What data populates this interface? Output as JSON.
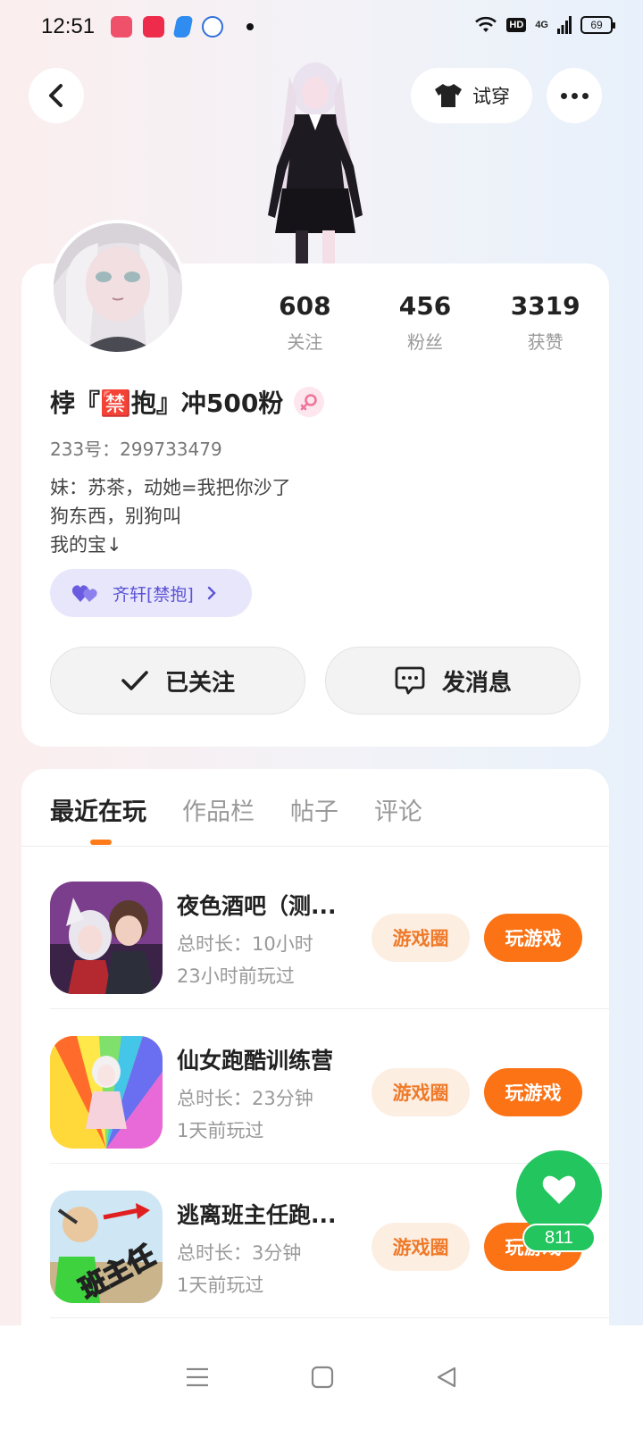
{
  "status": {
    "time": "12:51",
    "network": "4G",
    "hd": "HD",
    "battery": "69"
  },
  "header": {
    "tryon_label": "试穿"
  },
  "profile": {
    "stats": [
      {
        "value": "608",
        "label": "关注"
      },
      {
        "value": "456",
        "label": "粉丝"
      },
      {
        "value": "3319",
        "label": "获赞"
      }
    ],
    "username": "桲『🈲抱』冲500粉",
    "account_id": "233号：299733479",
    "bio": [
      "妹：苏茶，动她=我把你沙了",
      "狗东西，别狗叫",
      "我的宝↓"
    ],
    "couple_label": "齐轩[禁抱]",
    "follow_label": "已关注",
    "message_label": "发消息"
  },
  "tabs": [
    {
      "label": "最近在玩",
      "active": true
    },
    {
      "label": "作品栏",
      "active": false
    },
    {
      "label": "帖子",
      "active": false
    },
    {
      "label": "评论",
      "active": false
    }
  ],
  "games": [
    {
      "title": "夜色酒吧（测...",
      "duration": "总时长：10小时",
      "last_played": "23小时前玩过",
      "circle_label": "游戏圈",
      "play_label": "玩游戏"
    },
    {
      "title": "仙女跑酷训练营",
      "duration": "总时长：23分钟",
      "last_played": "1天前玩过",
      "circle_label": "游戏圈",
      "play_label": "玩游戏"
    },
    {
      "title": "逃离班主任跑...",
      "duration": "总时长：3分钟",
      "last_played": "1天前玩过",
      "circle_label": "游戏圈",
      "play_label": "玩游戏",
      "icon_text": "班主任"
    }
  ],
  "like": {
    "count": "811"
  },
  "colors": {
    "accent": "#fb7315",
    "like_green": "#22c55e",
    "couple_purple": "#5b53d6"
  }
}
